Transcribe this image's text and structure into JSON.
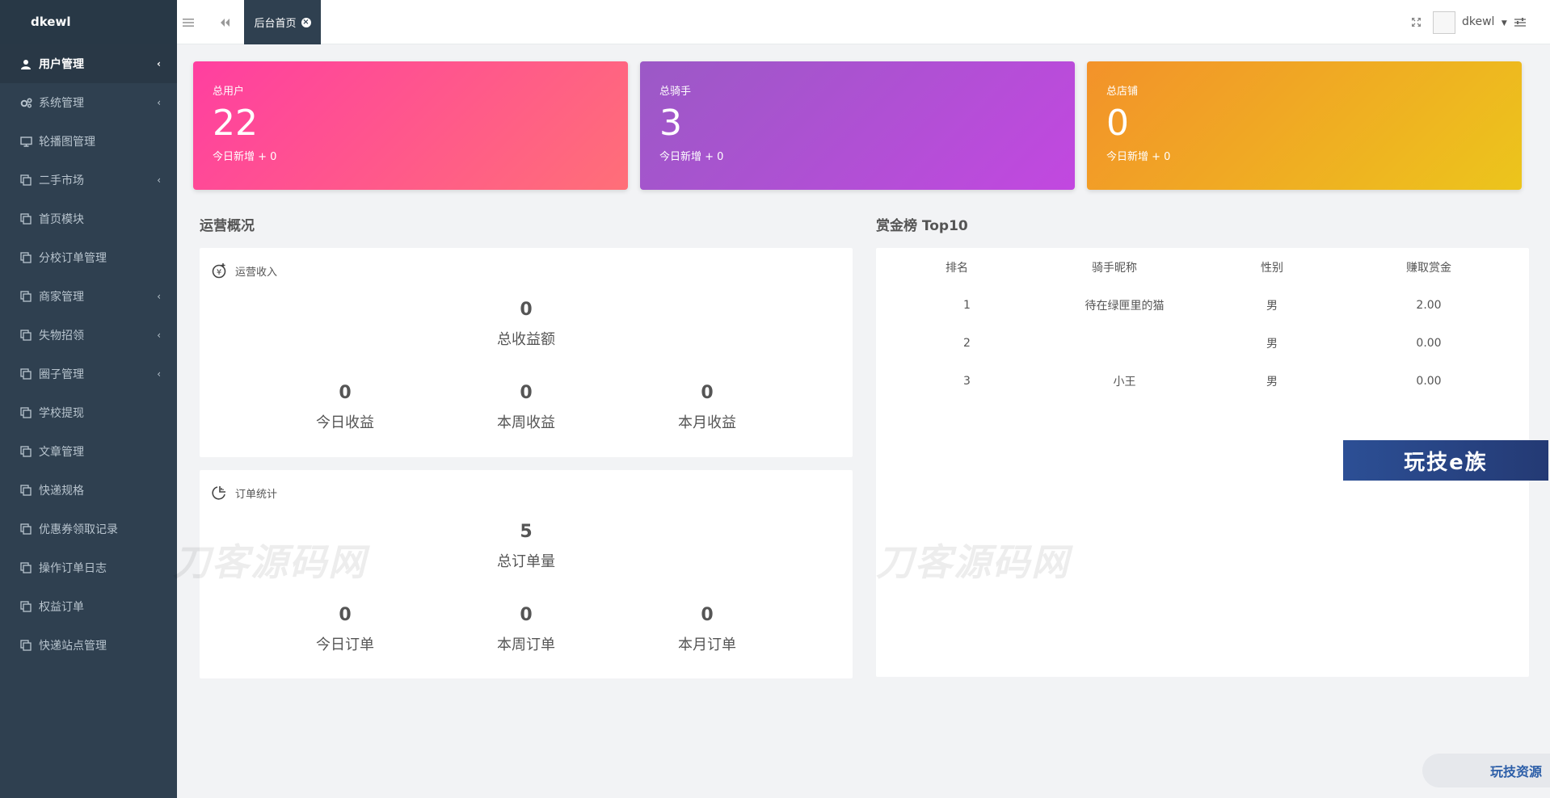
{
  "brand": "dkewl",
  "sidebar": {
    "items": [
      {
        "label": "用户管理",
        "icon": "user-icon",
        "chevron": true,
        "active": true
      },
      {
        "label": "系统管理",
        "icon": "gears-icon",
        "chevron": true
      },
      {
        "label": "轮播图管理",
        "icon": "monitor-icon",
        "chevron": false
      },
      {
        "label": "二手市场",
        "icon": "copy-icon",
        "chevron": true
      },
      {
        "label": "首页模块",
        "icon": "copy-icon",
        "chevron": false
      },
      {
        "label": "分校订单管理",
        "icon": "copy-icon",
        "chevron": false
      },
      {
        "label": "商家管理",
        "icon": "copy-icon",
        "chevron": true
      },
      {
        "label": "失物招领",
        "icon": "copy-icon",
        "chevron": true
      },
      {
        "label": "圈子管理",
        "icon": "copy-icon",
        "chevron": true
      },
      {
        "label": "学校提现",
        "icon": "copy-icon",
        "chevron": false
      },
      {
        "label": "文章管理",
        "icon": "copy-icon",
        "chevron": false
      },
      {
        "label": "快递规格",
        "icon": "copy-icon",
        "chevron": false
      },
      {
        "label": "优惠券领取记录",
        "icon": "copy-icon",
        "chevron": false
      },
      {
        "label": "操作订单日志",
        "icon": "copy-icon",
        "chevron": false
      },
      {
        "label": "权益订单",
        "icon": "copy-icon",
        "chevron": false
      },
      {
        "label": "快递站点管理",
        "icon": "copy-icon",
        "chevron": false
      }
    ]
  },
  "topbar": {
    "tab_label": "后台首页",
    "user_name": "dkewl"
  },
  "stats": [
    {
      "label": "总用户",
      "value": "22",
      "sub": "今日新增 + 0"
    },
    {
      "label": "总骑手",
      "value": "3",
      "sub": "今日新增 + 0"
    },
    {
      "label": "总店铺",
      "value": "0",
      "sub": "今日新增 + 0"
    }
  ],
  "overview": {
    "title": "运营概况",
    "revenue": {
      "head": "运营收入",
      "total_value": "0",
      "total_label": "总收益额",
      "today_value": "0",
      "today_label": "今日收益",
      "week_value": "0",
      "week_label": "本周收益",
      "month_value": "0",
      "month_label": "本月收益"
    },
    "orders": {
      "head": "订单统计",
      "total_value": "5",
      "total_label": "总订单量",
      "today_value": "0",
      "today_label": "今日订单",
      "week_value": "0",
      "week_label": "本周订单",
      "month_value": "0",
      "month_label": "本月订单"
    }
  },
  "ranking": {
    "title": "赏金榜 Top10",
    "headers": [
      "排名",
      "骑手昵称",
      "性别",
      "赚取赏金"
    ],
    "rows": [
      [
        "1",
        "待在绿匣里的猫",
        "男",
        "2.00"
      ],
      [
        "2",
        "",
        "男",
        "0.00"
      ],
      [
        "3",
        "小王",
        "男",
        "0.00"
      ]
    ]
  },
  "watermarks": {
    "site": "刀客源码网",
    "badge": "玩技e族",
    "pill": "玩技资源"
  },
  "colors": {
    "sidebar": "#2f4050",
    "card_pink": "#ff3fa0",
    "card_purple": "#b44fd6",
    "card_orange": "#f0aa24"
  }
}
